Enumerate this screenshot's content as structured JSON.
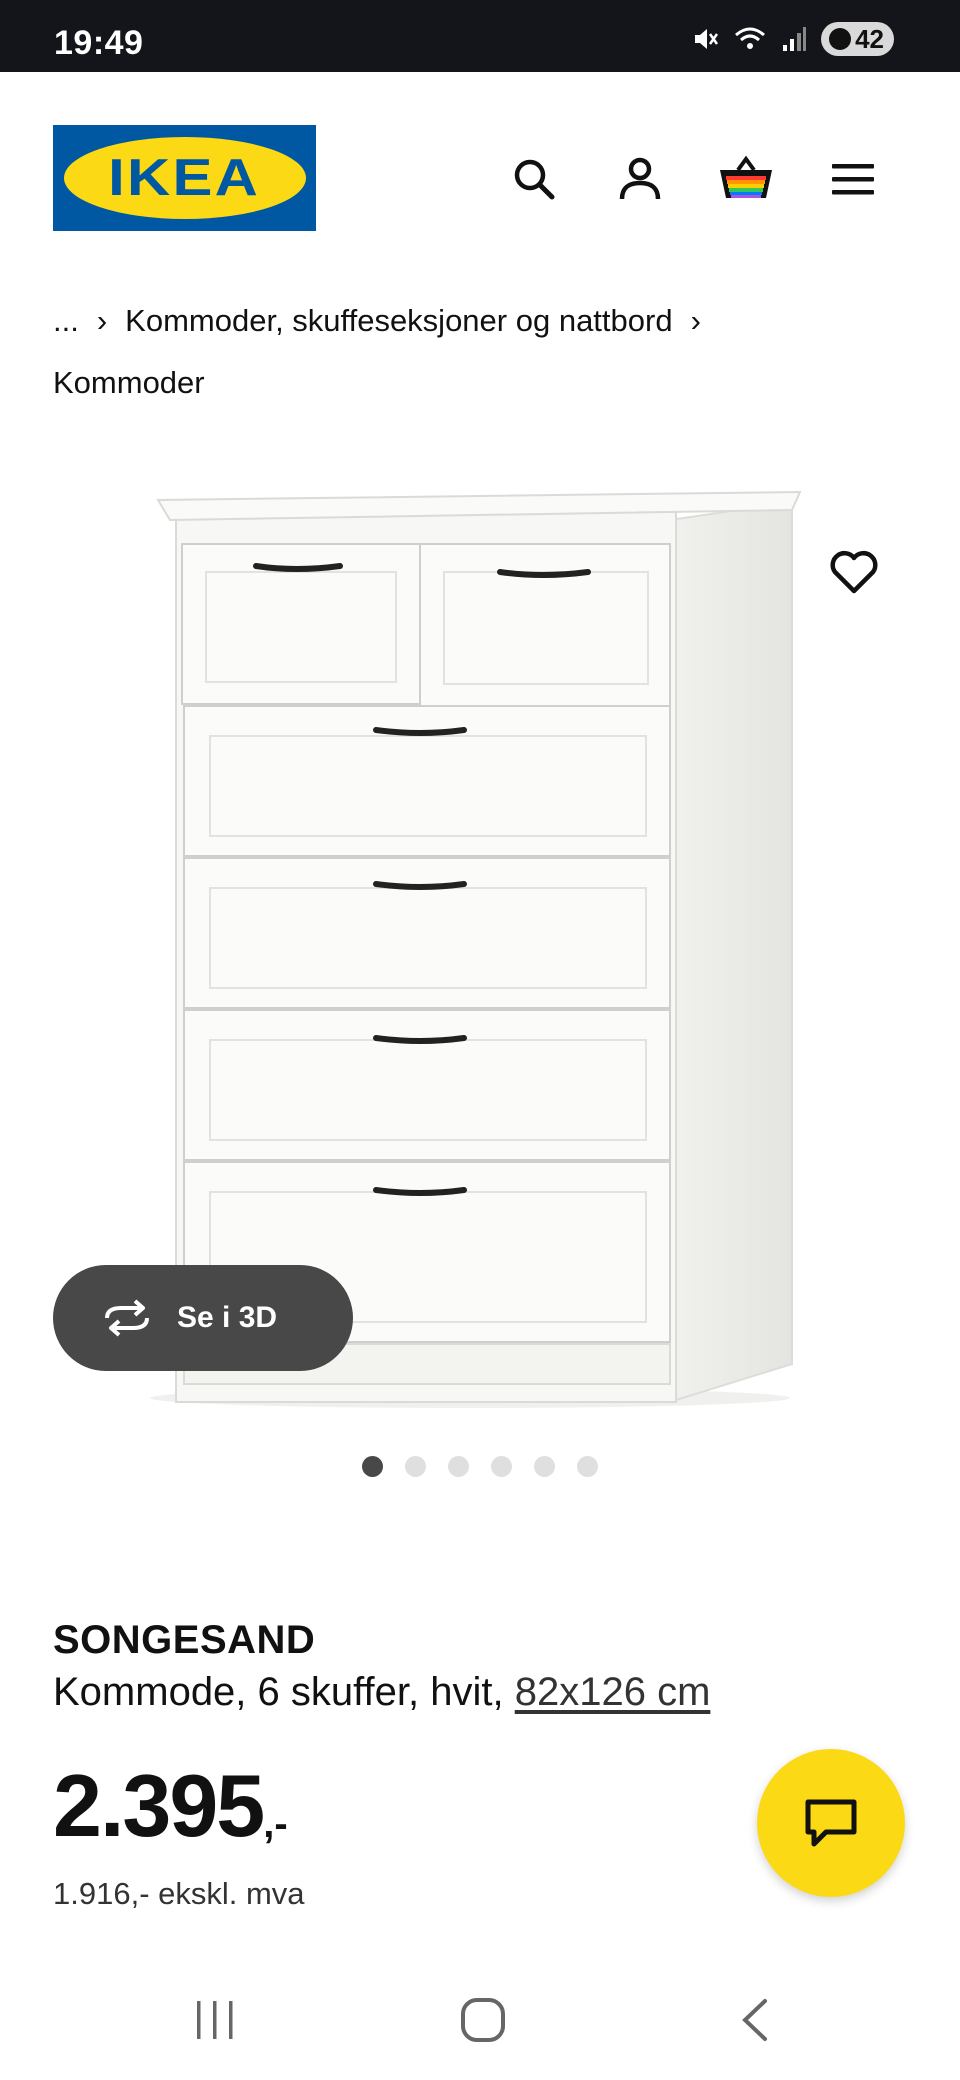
{
  "status_bar": {
    "time": "19:49",
    "battery": "42",
    "icons": [
      "mute-icon",
      "wifi-icon",
      "signal-icon",
      "battery-icon"
    ]
  },
  "header": {
    "logo_text": "IKEA",
    "colors": {
      "brand_blue": "#0058a3",
      "brand_yellow": "#fbd914"
    },
    "icons": [
      "search-icon",
      "profile-icon",
      "cart-icon",
      "menu-icon"
    ]
  },
  "breadcrumb": {
    "ellipsis": "...",
    "level1": "Kommoder, skuffeseksjoner og nattbord",
    "level2": "Kommoder"
  },
  "gallery": {
    "view_3d_label": "Se i 3D",
    "image_count": 6,
    "active_index": 0
  },
  "product": {
    "name": "SONGESAND",
    "description": "Kommode, 6 skuffer, hvit,",
    "measurement": "82x126 cm",
    "price": "2.395",
    "price_suffix": ",-",
    "price_excl_vat": "1.916,- ekskl. mva"
  },
  "fab": {
    "icon": "chat-icon",
    "color": "#fbd914"
  },
  "nav": {
    "icons": [
      "recent-apps-icon",
      "home-icon",
      "back-icon"
    ]
  }
}
